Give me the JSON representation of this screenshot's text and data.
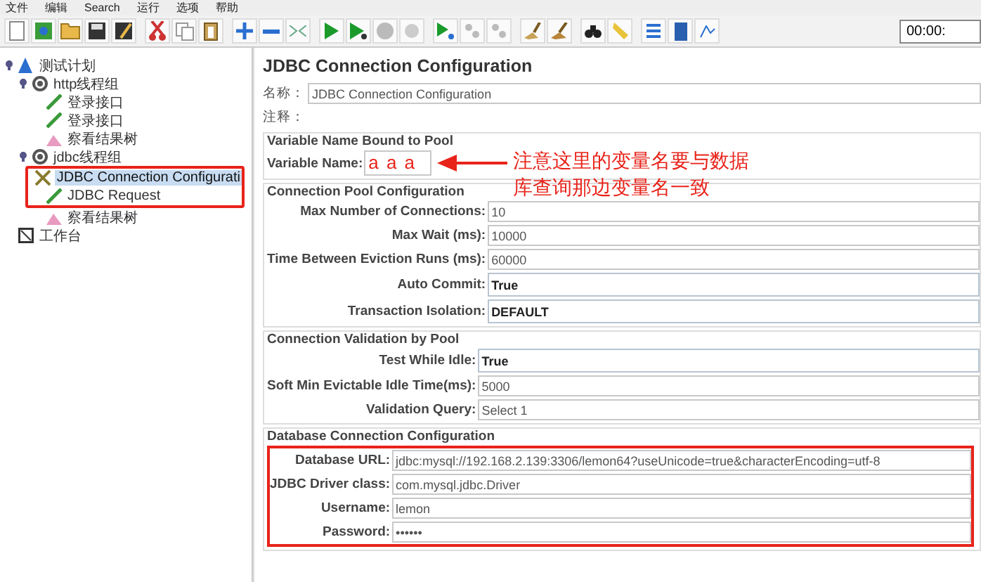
{
  "menu": [
    "文件",
    "编辑",
    "Search",
    "运行",
    "选项",
    "帮助"
  ],
  "toolbar": {
    "timer": "00:00:"
  },
  "tree": [
    {
      "label": "测试计划",
      "kind": "plan",
      "expanded": true,
      "selected": false,
      "highlighted": false,
      "children": [
        {
          "label": "http线程组",
          "kind": "group",
          "expanded": true,
          "selected": false,
          "highlighted": false,
          "children": [
            {
              "label": "登录接口",
              "kind": "sampler",
              "selected": false,
              "highlighted": false
            },
            {
              "label": "登录接口",
              "kind": "sampler",
              "selected": false,
              "highlighted": false
            },
            {
              "label": "察看结果树",
              "kind": "listener",
              "selected": false,
              "highlighted": false
            }
          ]
        },
        {
          "label": "jdbc线程组",
          "kind": "group",
          "expanded": true,
          "selected": false,
          "highlighted": false,
          "children": [
            {
              "label": "JDBC Connection Configurati",
              "kind": "config",
              "selected": true,
              "highlighted": true
            },
            {
              "label": "JDBC Request",
              "kind": "sampler",
              "selected": false,
              "highlighted": true
            },
            {
              "label": "察看结果树",
              "kind": "listener",
              "selected": false,
              "highlighted": false
            }
          ]
        }
      ]
    },
    {
      "label": "工作台",
      "kind": "workbench",
      "selected": false,
      "highlighted": false
    }
  ],
  "panel": {
    "title": "JDBC Connection Configuration",
    "name_label": "名称：",
    "name_value": "JDBC Connection Configuration",
    "comment_label": "注释：",
    "sections": [
      {
        "title": "Variable Name Bound to Pool",
        "highlighted": false,
        "rows": [
          {
            "label": "Variable Name:",
            "value": "a a a",
            "kind": "annotated"
          }
        ]
      },
      {
        "title": "Connection Pool Configuration",
        "highlighted": false,
        "rows": [
          {
            "label": "Max Number of Connections:",
            "value": "10",
            "kind": "text"
          },
          {
            "label": "Max Wait (ms):",
            "value": "10000",
            "kind": "text"
          },
          {
            "label": "Time Between Eviction Runs (ms):",
            "value": "60000",
            "kind": "text"
          },
          {
            "label": "Auto Commit:",
            "value": "True",
            "kind": "combo"
          },
          {
            "label": "Transaction Isolation:",
            "value": "DEFAULT",
            "kind": "combo"
          }
        ]
      },
      {
        "title": "Connection Validation by Pool",
        "highlighted": false,
        "rows": [
          {
            "label": "Test While Idle:",
            "value": "True",
            "kind": "combo"
          },
          {
            "label": "Soft Min Evictable Idle Time(ms):",
            "value": "5000",
            "kind": "text"
          },
          {
            "label": "Validation Query:",
            "value": "Select 1",
            "kind": "text"
          }
        ]
      },
      {
        "title": "Database Connection Configuration",
        "highlighted": true,
        "rows": [
          {
            "label": "Database URL:",
            "value": "jdbc:mysql://192.168.2.139:3306/lemon64?useUnicode=true&characterEncoding=utf-8",
            "kind": "text"
          },
          {
            "label": "JDBC Driver class:",
            "value": "com.mysql.jdbc.Driver",
            "kind": "text"
          },
          {
            "label": "Username:",
            "value": "lemon",
            "kind": "text"
          },
          {
            "label": "Password:",
            "value": "••••••",
            "kind": "text"
          }
        ]
      }
    ],
    "annotation": "注意这里的变量名要与数据库查询那边变量名一致"
  }
}
